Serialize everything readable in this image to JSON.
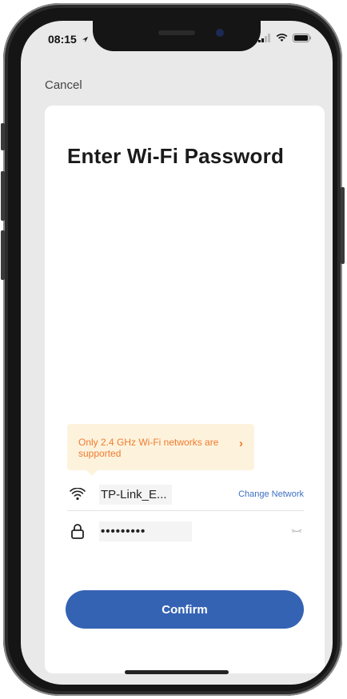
{
  "status_bar": {
    "time": "08:15",
    "icons": [
      "location-arrow-icon",
      "signal-icon",
      "wifi-icon",
      "battery-icon"
    ]
  },
  "nav": {
    "cancel_label": "Cancel"
  },
  "page": {
    "title": "Enter Wi-Fi Password"
  },
  "notice": {
    "text": "Only 2.4 GHz Wi-Fi networks are supported",
    "chevron": "›",
    "color": "#f07a2d",
    "background": "#fdf3dd"
  },
  "network": {
    "icon": "wifi-icon",
    "ssid": "TP-Link_E...",
    "change_label": "Change Network"
  },
  "password": {
    "icon": "lock-icon",
    "value": "•••••••••",
    "toggle_icon": "eye-closed-icon"
  },
  "actions": {
    "confirm_label": "Confirm",
    "confirm_color": "#3563b4"
  }
}
